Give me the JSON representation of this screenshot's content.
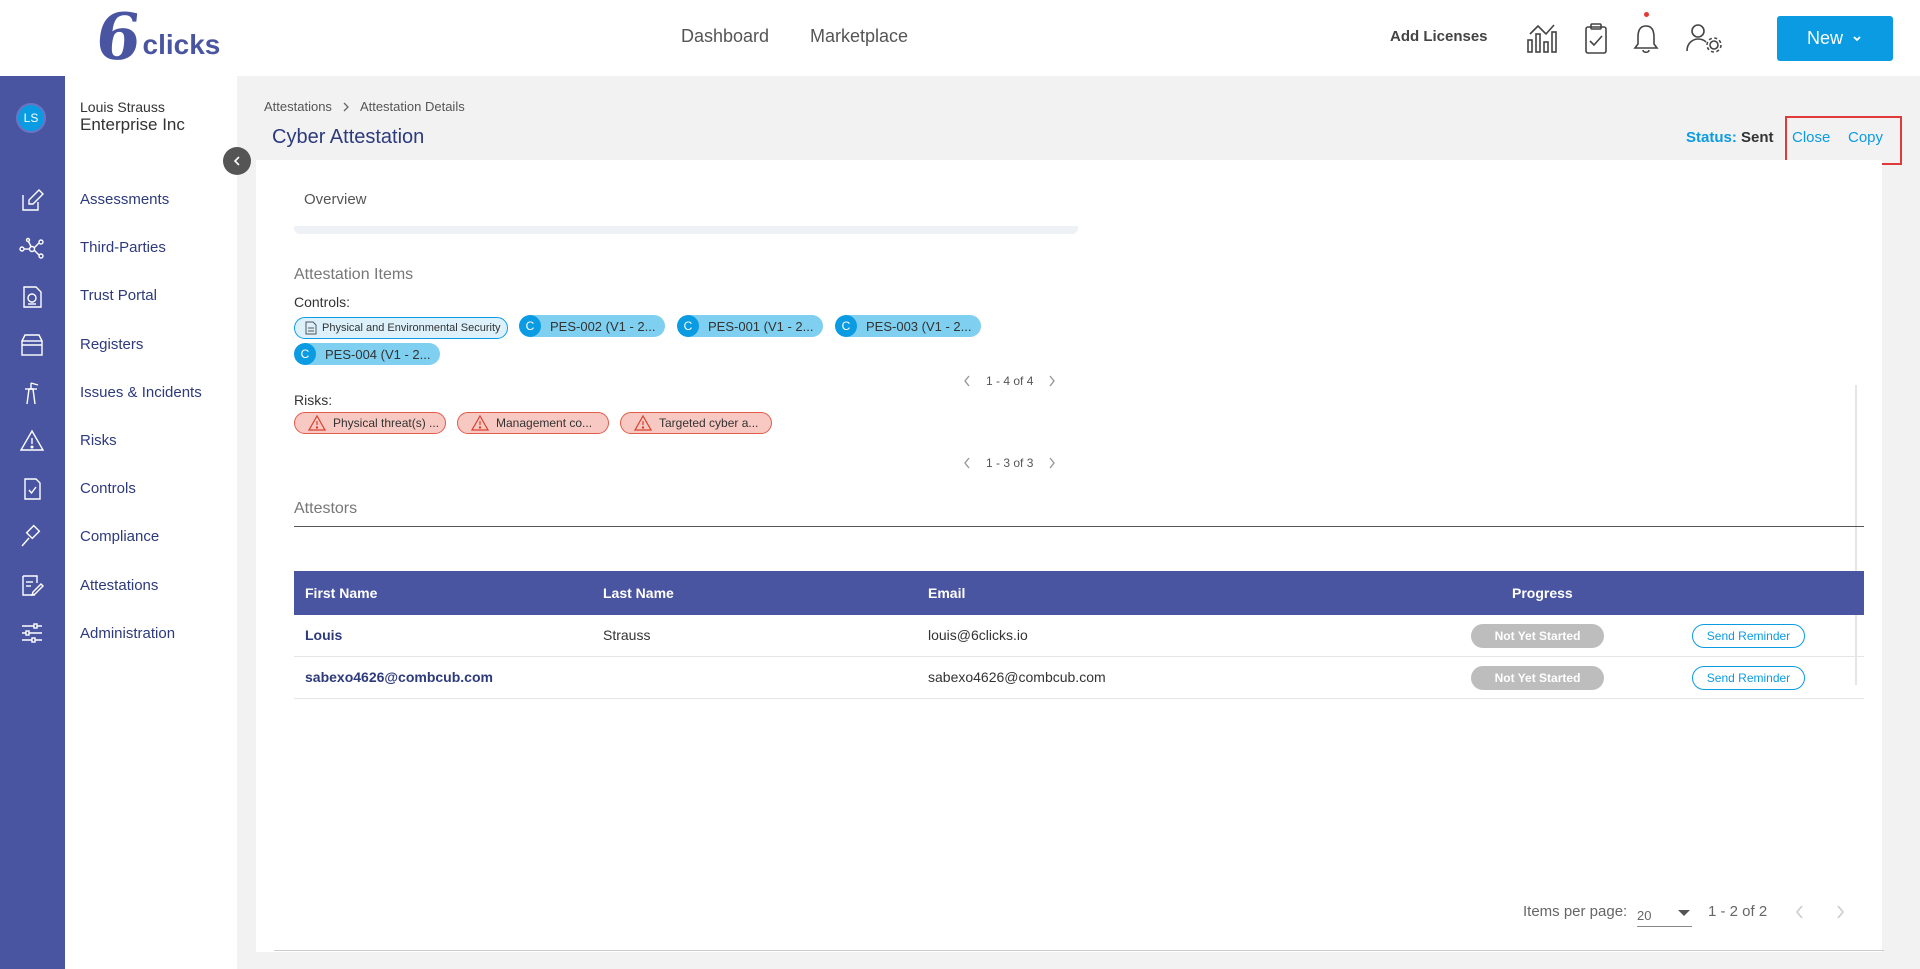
{
  "app": {
    "logo_text": "clicks",
    "logo_glyph": "6"
  },
  "topbar": {
    "nav": [
      "Dashboard",
      "Marketplace"
    ],
    "add_licenses": "Add Licenses",
    "new_button": "New",
    "icons": [
      "analytics-chart-icon",
      "clipboard-check-icon",
      "bell-icon",
      "user-settings-icon"
    ]
  },
  "rail": {
    "avatar_initials": "LS",
    "icons": [
      "edit-icon",
      "network-icon",
      "trust-portal-icon",
      "registers-box-icon",
      "issues-incidents-icon",
      "warning-triangle-icon",
      "controls-doc-icon",
      "compliance-gavel-icon",
      "attestations-icon",
      "administration-sliders-icon"
    ]
  },
  "sidemenu": {
    "user_name": "Louis Strauss",
    "org_name": "Enterprise Inc",
    "items": [
      "Assessments",
      "Third-Parties",
      "Trust Portal",
      "Registers",
      "Issues & Incidents",
      "Risks",
      "Controls",
      "Compliance",
      "Attestations",
      "Administration"
    ]
  },
  "breadcrumb": [
    "Attestations",
    "Attestation Details"
  ],
  "page": {
    "title": "Cyber Attestation",
    "status_label": "Status:",
    "status_value": "Sent",
    "close_label": "Close",
    "copy_label": "Copy"
  },
  "overview_tab": "Overview",
  "attestation_items": {
    "title": "Attestation Items",
    "controls_label": "Controls:",
    "control_doc_chip": "Physical and Environmental Security",
    "control_badge": "C",
    "controls": [
      "PES-002 (V1 - 2...",
      "PES-001 (V1 - 2...",
      "PES-003 (V1 - 2...",
      "PES-004 (V1 - 2..."
    ],
    "controls_pager": "1 - 4 of 4",
    "risks_label": "Risks:",
    "risks": [
      "Physical threat(s) ...",
      "Management co...",
      "Targeted cyber a..."
    ],
    "risks_pager": "1 - 3 of 3"
  },
  "attestors": {
    "title": "Attestors",
    "columns": [
      "First Name",
      "Last Name",
      "Email",
      "Progress"
    ],
    "rows": [
      {
        "first_name": "Louis",
        "last_name": "Strauss",
        "email": "louis@6clicks.io",
        "progress": "Not Yet Started",
        "action": "Send Reminder"
      },
      {
        "first_name": "sabexo4626@combcub.com",
        "last_name": "",
        "email": "sabexo4626@combcub.com",
        "progress": "Not Yet Started",
        "action": "Send Reminder"
      }
    ]
  },
  "paginator": {
    "items_per_page_label": "Items per page:",
    "items_per_page": "20",
    "range": "1 - 2 of 2"
  },
  "colors": {
    "brand": "#4a55a2",
    "accent": "#0b9be3",
    "risk": "#e25b4b",
    "highlight": "#e03a3a"
  }
}
